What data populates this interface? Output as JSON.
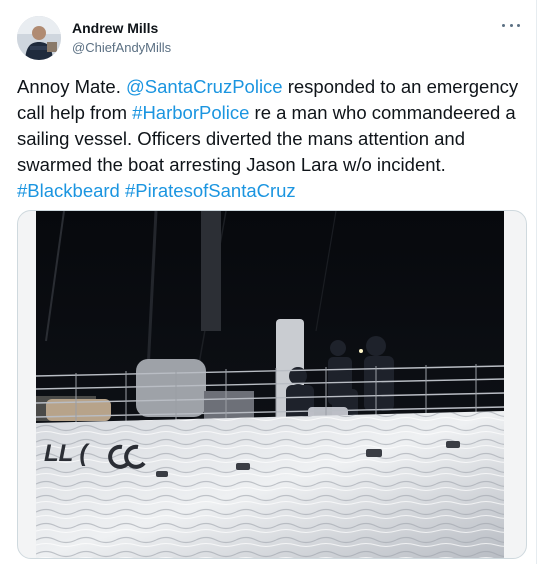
{
  "tweet": {
    "author_name": "Andrew Mills",
    "author_handle": "@ChiefAndyMills",
    "avatar_icon": "profile-photo",
    "more_icon": "more-horizontal-icon",
    "text_parts": {
      "p1": "Annoy Mate. ",
      "mention_scpd": "@SantaCruzPolice",
      "p2": " responded to an emergency call help from ",
      "hashtag_harbor": "#HarborPolice",
      "p3": " re a man who commandeered a sailing vessel. Officers diverted the mans attention and swarmed the boat arresting Jason Lara w/o incident. ",
      "hashtag_blackbeard": "#Blackbeard",
      "p4": " ",
      "hashtag_pirates": "#PiratesofSantaCruz"
    },
    "link_color": "#1b95e0",
    "media": {
      "hull_lettering": "LL ("
    }
  }
}
